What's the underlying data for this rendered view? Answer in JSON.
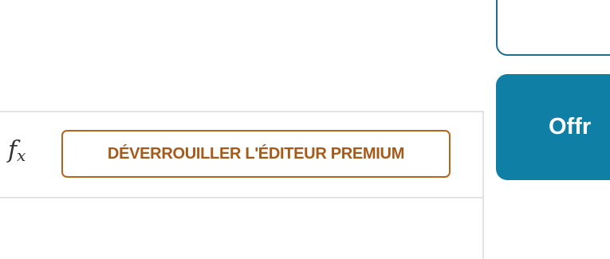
{
  "formula_bar": {
    "fx_icon": "formula-icon",
    "fx_symbol": "f",
    "fx_sub": "x",
    "unlock_label": "DÉVERROUILLER L'ÉDITEUR PREMIUM"
  },
  "side_panel": {
    "offer_label": "Offr"
  },
  "colors": {
    "accent_blue": "#0f7fa6",
    "premium_orange": "#b5651d",
    "border_gray": "#e3e3e3"
  }
}
